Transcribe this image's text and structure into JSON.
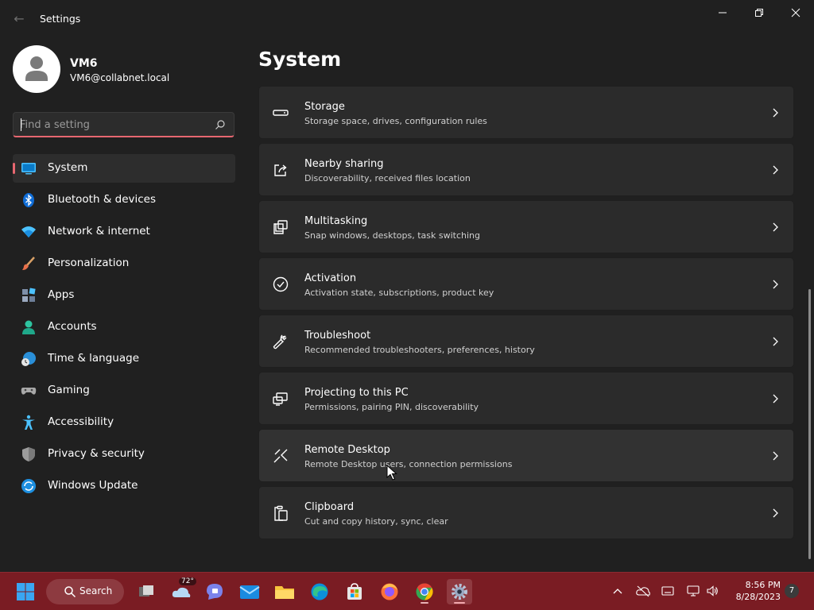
{
  "window": {
    "title": "Settings"
  },
  "user": {
    "name": "VM6",
    "email": "VM6@collabnet.local"
  },
  "search": {
    "placeholder": "Find a setting",
    "value": ""
  },
  "nav": {
    "items": [
      {
        "label": "System",
        "icon": "monitor-icon",
        "selected": true
      },
      {
        "label": "Bluetooth & devices",
        "icon": "bluetooth-icon"
      },
      {
        "label": "Network & internet",
        "icon": "wifi-icon"
      },
      {
        "label": "Personalization",
        "icon": "paintbrush-icon"
      },
      {
        "label": "Apps",
        "icon": "apps-icon"
      },
      {
        "label": "Accounts",
        "icon": "person-icon"
      },
      {
        "label": "Time & language",
        "icon": "globe-clock-icon"
      },
      {
        "label": "Gaming",
        "icon": "gamepad-icon"
      },
      {
        "label": "Accessibility",
        "icon": "accessibility-icon"
      },
      {
        "label": "Privacy & security",
        "icon": "shield-icon"
      },
      {
        "label": "Windows Update",
        "icon": "update-icon"
      }
    ]
  },
  "main": {
    "title": "System",
    "cards": [
      {
        "title": "Storage",
        "desc": "Storage space, drives, configuration rules",
        "icon": "storage-icon"
      },
      {
        "title": "Nearby sharing",
        "desc": "Discoverability, received files location",
        "icon": "share-icon"
      },
      {
        "title": "Multitasking",
        "desc": "Snap windows, desktops, task switching",
        "icon": "multitasking-icon"
      },
      {
        "title": "Activation",
        "desc": "Activation state, subscriptions, product key",
        "icon": "checkmark-circle-icon"
      },
      {
        "title": "Troubleshoot",
        "desc": "Recommended troubleshooters, preferences, history",
        "icon": "wrench-icon"
      },
      {
        "title": "Projecting to this PC",
        "desc": "Permissions, pairing PIN, discoverability",
        "icon": "projection-icon"
      },
      {
        "title": "Remote Desktop",
        "desc": "Remote Desktop users, connection permissions",
        "icon": "remote-desktop-icon",
        "hover": true
      },
      {
        "title": "Clipboard",
        "desc": "Cut and copy history, sync, clear",
        "icon": "clipboard-icon"
      }
    ]
  },
  "taskbar": {
    "search_label": "Search",
    "weather_temp": "72°",
    "time": "8:56 PM",
    "date": "8/28/2023",
    "notification_count": "7",
    "apps": [
      "start-icon",
      "task-view-icon",
      "weather-icon",
      "teams-chat-icon",
      "mail-icon",
      "file-explorer-icon",
      "edge-icon",
      "store-icon",
      "firefox-icon",
      "chrome-icon",
      "settings-icon"
    ]
  },
  "colors": {
    "accent": "#e76770",
    "taskbar": "#7a1c23",
    "background": "#202020",
    "card": "#2b2b2b"
  }
}
